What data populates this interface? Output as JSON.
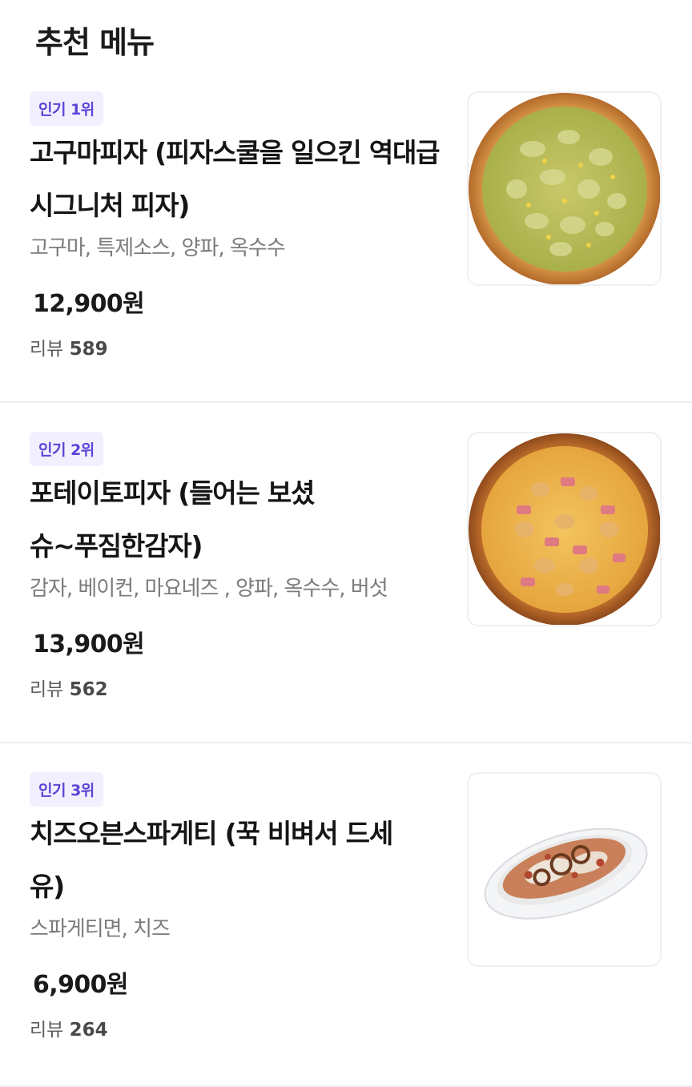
{
  "section": {
    "title": "추천 메뉴"
  },
  "items": [
    {
      "badge": "인기 1위",
      "name": "고구마피자 (피자스쿨을 일으킨 역대급 시그니처 피자)",
      "description": "고구마, 특제소스, 양파, 옥수수",
      "price": "12,900원",
      "review_label": "리뷰",
      "review_count": "589",
      "image": "sweet-potato-pizza-image"
    },
    {
      "badge": "인기 2위",
      "name": "포테이토피자 (들어는 보셨슈~푸짐한감자)",
      "description": "감자, 베이컨, 마요네즈 , 양파, 옥수수, 버섯",
      "price": "13,900원",
      "review_label": "리뷰",
      "review_count": "562",
      "image": "potato-pizza-image"
    },
    {
      "badge": "인기 3위",
      "name": "치즈오븐스파게티 (꾹 비벼서 드세유)",
      "description": "스파게티면, 치즈",
      "price": "6,900원",
      "review_label": "리뷰",
      "review_count": "264",
      "image": "cheese-oven-spaghetti-image"
    }
  ],
  "colors": {
    "badge_bg": "#f2efff",
    "badge_text": "#5b45d6",
    "divider": "#eeeeee"
  }
}
